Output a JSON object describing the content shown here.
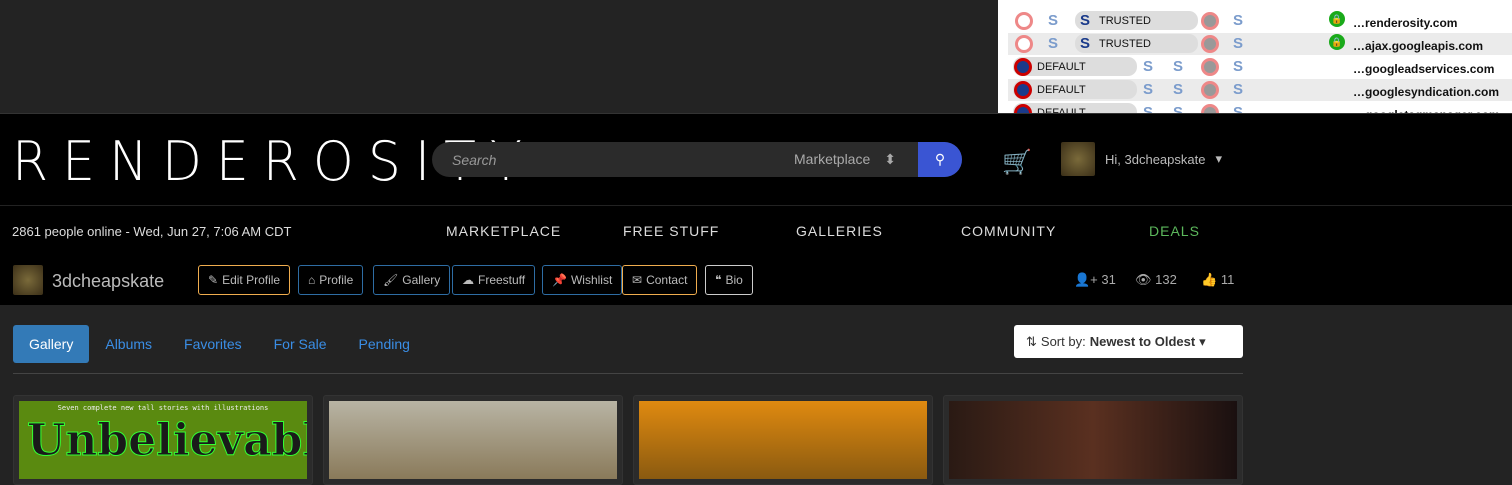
{
  "overlay": {
    "rows": [
      {
        "status": "TRUSTED",
        "domain": "…renderosity.com",
        "secure": true
      },
      {
        "status": "TRUSTED",
        "domain": "…ajax.googleapis.com",
        "secure": true
      },
      {
        "status": "DEFAULT",
        "domain": "…googleadservices.com",
        "secure": false
      },
      {
        "status": "DEFAULT",
        "domain": "…googlesyndication.com",
        "secure": false
      },
      {
        "status": "DEFAULT",
        "domain": "…googletagmanager.com",
        "secure": false
      }
    ]
  },
  "header": {
    "logo": "RENDEROSITY",
    "search_placeholder": "Search",
    "search_scope": "Marketplace",
    "greeting": "Hi, 3dcheapskate"
  },
  "nav": {
    "online": "2861 people online  -  Wed, Jun 27, 7:06 AM CDT",
    "items": [
      "MARKETPLACE",
      "FREE STUFF",
      "GALLERIES",
      "COMMUNITY",
      "DEALS"
    ],
    "deals_color": "#5cb85c"
  },
  "profile": {
    "username": "3dcheapskate",
    "buttons": [
      "Edit Profile",
      "Profile",
      "Gallery",
      "Freestuff",
      "Wishlist",
      "Contact",
      "Bio"
    ],
    "followers": "31",
    "views": "132",
    "likes": "11"
  },
  "gallery": {
    "tabs": [
      "Gallery",
      "Albums",
      "Favorites",
      "For Sale",
      "Pending"
    ],
    "sort_label": "Sort by:",
    "sort_value": "Newest to Oldest",
    "card1_caption": "Seven complete new tall stories with illustrations",
    "card1_title": "Unbelievable"
  }
}
